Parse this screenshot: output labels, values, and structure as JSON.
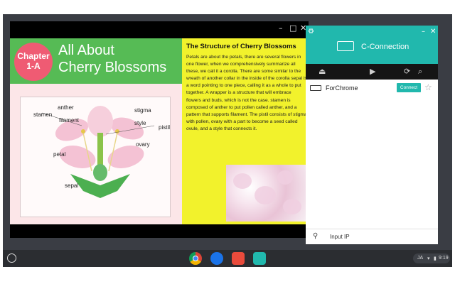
{
  "slide_window": {
    "controls": {
      "minimize": "–",
      "maximize": "□",
      "close": "✕"
    },
    "chapter_badge": {
      "line1": "Chapter",
      "line2": "1-A"
    },
    "title": {
      "line1": "All About",
      "line2": "Cherry Blossoms"
    },
    "diagram_labels": {
      "stamen": "stamen",
      "anther": "anther",
      "filament": "filament",
      "stigma": "stigma",
      "style": "style",
      "pistil": "pistil",
      "ovary": "ovary",
      "petal": "petal",
      "sepal": "sepal"
    },
    "right": {
      "heading": "The Structure of Cherry Blossoms",
      "paragraph": "Petals are about the petals, there are several flowers in one flower, when we comprehensively summarize all these, we call it a corolla. There are some similar to the wreath of another collar in the inside of the corolla sepal is a word pointing to one piece, calling it as a whole to put together. A wrapper is a structure that will embrace flowers and buds, which is not the case. stamen is composed of anther to put pollen called anther, and a pattern that supports filament. The pistil consists of stigma with pollen, ovary with a part to become a seed called ovule, and a style that connects it."
    }
  },
  "cc_window": {
    "title": "C-Connection",
    "controls": {
      "settings": "⚙",
      "minimize": "–",
      "close": "✕"
    },
    "toolbar_icons": [
      "eject-icon",
      "play-icon",
      "refresh-icon",
      "search-icon"
    ],
    "toolbar_glyphs": {
      "eject": "⏏",
      "play": "▶",
      "refresh": "⟳",
      "search": "⌕"
    },
    "device": {
      "name": "ForChrome",
      "connect_label": "Connect",
      "star": "☆"
    },
    "footer": {
      "link_glyph": "⚲",
      "label": "Input IP"
    }
  },
  "shelf": {
    "apps": [
      {
        "name": "chrome",
        "color": "#db4437"
      },
      {
        "name": "files",
        "color": "#1a73e8"
      },
      {
        "name": "gallery",
        "color": "#e94b3c"
      },
      {
        "name": "c-connection",
        "color": "#21b8ad"
      }
    ],
    "tray": {
      "ime": "JA",
      "time": "9:19"
    }
  }
}
